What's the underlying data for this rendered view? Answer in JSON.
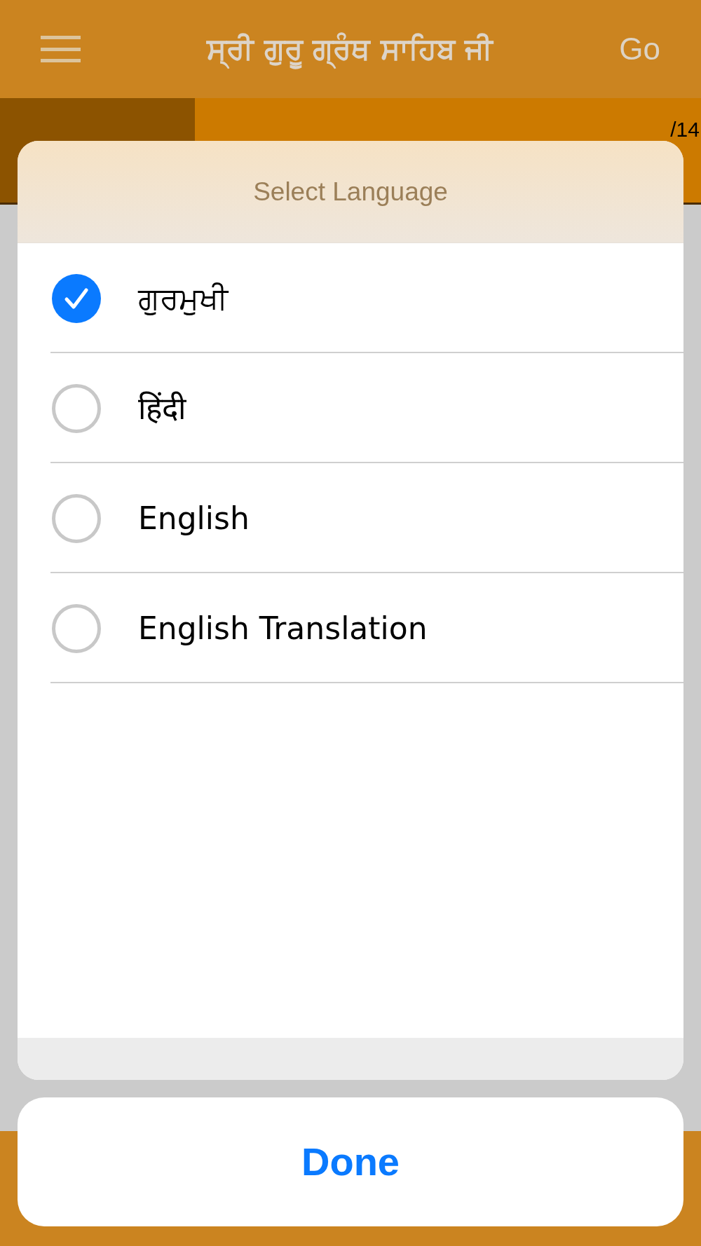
{
  "nav_bar": {
    "title": "ਸ੍ਰੀ ਗੁਰੂ ਗ੍ਰੰਥ ਸਾਹਿਬ ਜੀ",
    "go_button": "Go"
  },
  "segment_bar": {
    "segments": [
      {
        "selected": true
      },
      {
        "selected": false,
        "text": "/14"
      }
    ]
  },
  "language_picker": {
    "title": "Select Language",
    "options": [
      {
        "label": "ਗੁਰਮੁਖੀ",
        "selected": true
      },
      {
        "label": "हिंदी",
        "selected": false
      },
      {
        "label": "English",
        "selected": false
      },
      {
        "label": "English Translation",
        "selected": false
      }
    ]
  },
  "done_button": "Done"
}
